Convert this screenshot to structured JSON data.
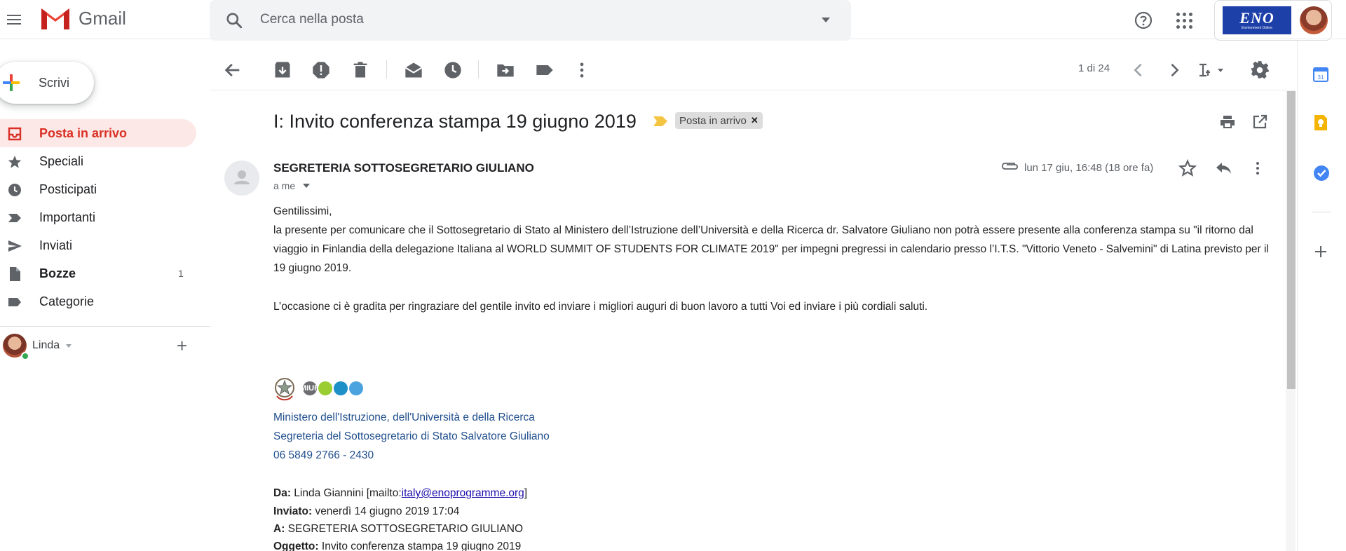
{
  "header": {
    "app_name": "Gmail",
    "search_placeholder": "Cerca nella posta",
    "account_logo_text": "ENO",
    "account_logo_subtext": "Environment Online"
  },
  "sidebar": {
    "compose_label": "Scrivi",
    "items": [
      {
        "label": "Posta in arrivo",
        "icon": "inbox-icon",
        "active": true,
        "count": ""
      },
      {
        "label": "Speciali",
        "icon": "star-icon",
        "active": false,
        "count": ""
      },
      {
        "label": "Posticipati",
        "icon": "clock-icon",
        "active": false,
        "count": ""
      },
      {
        "label": "Importanti",
        "icon": "important-icon",
        "active": false,
        "count": ""
      },
      {
        "label": "Inviati",
        "icon": "send-icon",
        "active": false,
        "count": ""
      },
      {
        "label": "Bozze",
        "icon": "draft-icon",
        "active": false,
        "count": "1"
      },
      {
        "label": "Categorie",
        "icon": "label-icon",
        "active": false,
        "count": ""
      }
    ],
    "chat_user": "Linda"
  },
  "toolbar": {
    "pager": "1 di 24"
  },
  "message": {
    "subject": "I: Invito conferenza stampa 19 giugno 2019",
    "label_chip": "Posta in arrivo",
    "sender": "SEGRETERIA SOTTOSEGRETARIO GIULIANO",
    "to": "a me",
    "date": "lun 17 giu, 16:48 (18 ore fa)",
    "greeting": "Gentilissimi,",
    "paragraph1": "la presente per comunicare che il Sottosegretario di Stato al Ministero dell’Istruzione dell’Università e della Ricerca dr. Salvatore Giuliano non potrà essere presente alla conferenza stampa su \"il ritorno dal viaggio in Finlandia della delegazione Italiana al WORLD SUMMIT OF STUDENTS FOR CLIMATE 2019\" per impegni pregressi in calendario presso l’I.T.S. \"Vittorio Veneto - Salvemini\" di Latina previsto per il 19 giugno 2019.",
    "paragraph2": "L’occasione ci è gradita per ringraziare del gentile invito ed inviare i migliori auguri di buon lavoro a tutti Voi ed inviare i più cordiali saluti.",
    "signature": {
      "logo_text": "MIUR",
      "line1": "Ministero dell'Istruzione, dell'Università e della Ricerca",
      "line2": "Segreteria del Sottosegretario di Stato Salvatore Giuliano",
      "line3": "06 5849 2766 - 2430"
    },
    "forwarded": {
      "from_label": "Da:",
      "from_value": "Linda Giannini [mailto:",
      "from_link": "italy@enoprogramme.org",
      "from_close": "]",
      "sent_label": "Inviato:",
      "sent_value": "venerdì 14 giugno 2019 17:04",
      "to_label": "A:",
      "to_value": "SEGRETERIA SOTTOSEGRETARIO GIULIANO",
      "subject_label": "Oggetto:",
      "subject_value": "Invito conferenza stampa 19 giugno 2019"
    }
  },
  "colors": {
    "active_nav_bg": "#fce8e6",
    "active_nav_text": "#d93025",
    "signature_blue": "#1f4e8c"
  }
}
